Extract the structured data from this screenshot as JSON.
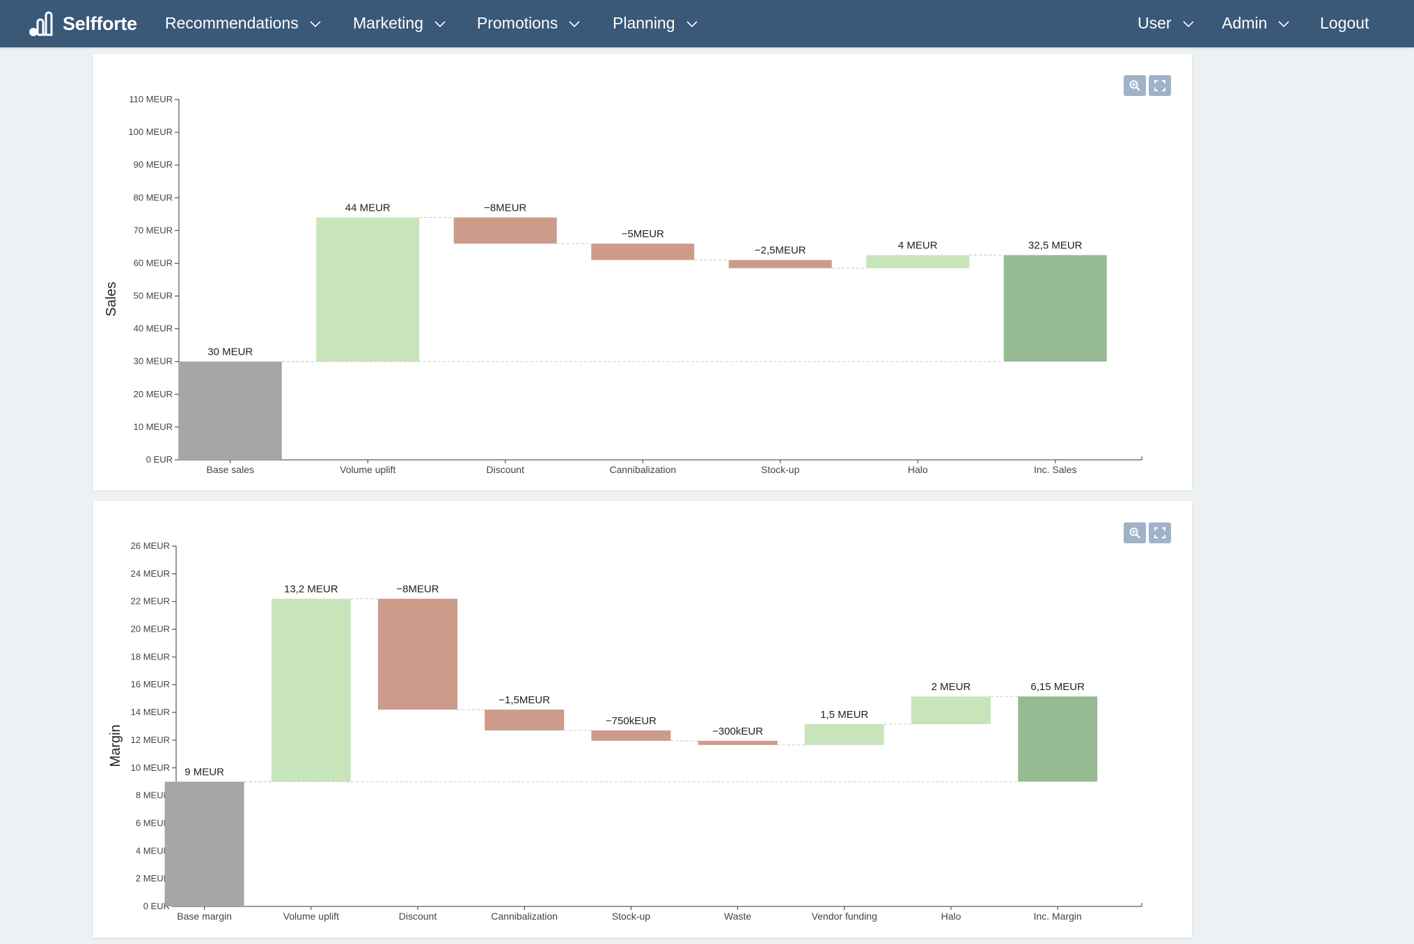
{
  "app": {
    "brand": "Selfforte"
  },
  "nav": {
    "left": [
      {
        "label": "Recommendations"
      },
      {
        "label": "Marketing"
      },
      {
        "label": "Promotions"
      },
      {
        "label": "Planning"
      }
    ],
    "right": [
      {
        "label": "User"
      },
      {
        "label": "Admin"
      },
      {
        "label": "Logout"
      }
    ]
  },
  "colors": {
    "navbar": "#3a5878",
    "base": "#a6a6a6",
    "increase": "#c8e4bb",
    "decrease": "#cd9b8a",
    "total": "#96ba92",
    "toolbar_button": "#9fb2c8"
  },
  "icons": [
    "zoom-icon",
    "fullscreen-icon",
    "chevron-down-icon",
    "logo-icon"
  ],
  "chart_data": [
    {
      "type": "waterfall",
      "ylabel": "Sales",
      "xlabel": "",
      "ylim": [
        0,
        110
      ],
      "unit": "MEUR",
      "grid": false,
      "yticks": [
        "0 EUR",
        "10 MEUR",
        "20 MEUR",
        "30 MEUR",
        "40 MEUR",
        "50 MEUR",
        "60 MEUR",
        "70 MEUR",
        "80 MEUR",
        "90 MEUR",
        "100 MEUR",
        "110 MEUR"
      ],
      "bars": [
        {
          "category": "Base sales",
          "start": 0,
          "end": 30,
          "kind": "base",
          "label": "30 MEUR"
        },
        {
          "category": "Volume uplift",
          "start": 30,
          "end": 74,
          "kind": "increase",
          "label": "44 MEUR"
        },
        {
          "category": "Discount",
          "start": 74,
          "end": 66,
          "kind": "decrease",
          "label": "−8MEUR"
        },
        {
          "category": "Cannibalization",
          "start": 66,
          "end": 61,
          "kind": "decrease",
          "label": "−5MEUR"
        },
        {
          "category": "Stock-up",
          "start": 61,
          "end": 58.5,
          "kind": "decrease",
          "label": "−2,5MEUR"
        },
        {
          "category": "Halo",
          "start": 58.5,
          "end": 62.5,
          "kind": "increase",
          "label": "4 MEUR"
        },
        {
          "category": "Inc. Sales",
          "start": 30,
          "end": 62.5,
          "kind": "total",
          "label": "32,5 MEUR"
        }
      ]
    },
    {
      "type": "waterfall",
      "ylabel": "Margin",
      "xlabel": "",
      "ylim": [
        0,
        26
      ],
      "unit": "MEUR",
      "grid": false,
      "yticks": [
        "0 EUR",
        "2 MEUR",
        "4 MEUR",
        "6 MEUR",
        "8 MEUR",
        "10 MEUR",
        "12 MEUR",
        "14 MEUR",
        "16 MEUR",
        "18 MEUR",
        "20 MEUR",
        "22 MEUR",
        "24 MEUR",
        "26 MEUR"
      ],
      "bars": [
        {
          "category": "Base margin",
          "start": 0,
          "end": 9,
          "kind": "base",
          "label": "9 MEUR"
        },
        {
          "category": "Volume uplift",
          "start": 9,
          "end": 22.2,
          "kind": "increase",
          "label": "13,2 MEUR"
        },
        {
          "category": "Discount",
          "start": 22.2,
          "end": 14.2,
          "kind": "decrease",
          "label": "−8MEUR"
        },
        {
          "category": "Cannibalization",
          "start": 14.2,
          "end": 12.7,
          "kind": "decrease",
          "label": "−1,5MEUR"
        },
        {
          "category": "Stock-up",
          "start": 12.7,
          "end": 11.95,
          "kind": "decrease",
          "label": "−750kEUR"
        },
        {
          "category": "Waste",
          "start": 11.95,
          "end": 11.65,
          "kind": "decrease",
          "label": "−300kEUR"
        },
        {
          "category": "Vendor funding",
          "start": 11.65,
          "end": 13.15,
          "kind": "increase",
          "label": "1,5 MEUR"
        },
        {
          "category": "Halo",
          "start": 13.15,
          "end": 15.15,
          "kind": "increase",
          "label": "2 MEUR"
        },
        {
          "category": "Inc. Margin",
          "start": 9,
          "end": 15.15,
          "kind": "total",
          "label": "6,15 MEUR"
        }
      ]
    }
  ]
}
